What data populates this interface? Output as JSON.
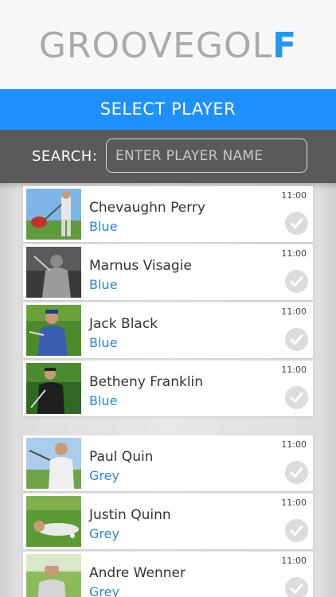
{
  "header": {
    "logo_main": "GROOVEGOL",
    "logo_accent": "F"
  },
  "title_bar": {
    "title": "SELECT PLAYER"
  },
  "search": {
    "label": "SEARCH:",
    "placeholder": "ENTER PLAYER NAME",
    "value": ""
  },
  "players": [
    {
      "name": "Chevaughn Perry",
      "group": "Blue",
      "time": "11:00",
      "checkmark_icon": "check-icon"
    },
    {
      "name": "Marnus Visagie",
      "group": "Blue",
      "time": "11:00",
      "checkmark_icon": "check-icon"
    },
    {
      "name": "Jack Black",
      "group": "Blue",
      "time": "11:00",
      "checkmark_icon": "check-icon"
    },
    {
      "name": "Betheny Franklin",
      "group": "Blue",
      "time": "11:00",
      "checkmark_icon": "check-icon"
    },
    {
      "name": "Paul Quin",
      "group": "Grey",
      "time": "11:00",
      "checkmark_icon": "check-icon"
    },
    {
      "name": "Justin Quinn",
      "group": "Grey",
      "time": "11:00",
      "checkmark_icon": "check-icon"
    },
    {
      "name": "Andre Wenner",
      "group": "Grey",
      "time": "11:00",
      "checkmark_icon": "check-icon"
    }
  ],
  "colors": {
    "brand_blue": "#1e90ff",
    "group_text": "#2a86d8",
    "search_bar": "#5a5a5a"
  }
}
